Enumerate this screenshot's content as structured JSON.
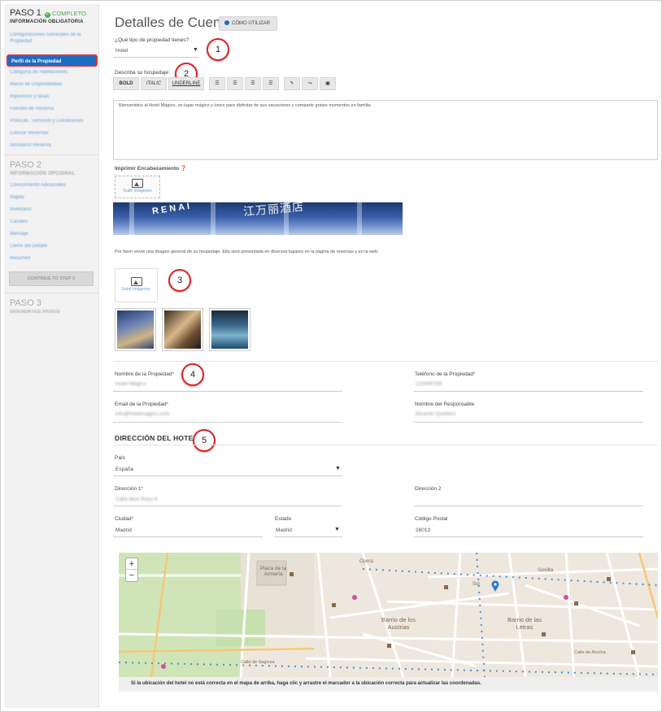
{
  "sidebar": {
    "step1": {
      "title": "PASO 1",
      "status": "COMPLETO",
      "subtitle": "INFORMACIÓN OBLIGATORIA"
    },
    "step1_items": [
      {
        "label": "Configuraciones Generales de la Propiedad"
      },
      {
        "label": "Perfil de la Propiedad",
        "active": true
      },
      {
        "label": "Categoría de Habitaciones"
      },
      {
        "label": "Marco de Disponibilidad"
      },
      {
        "label": "Impuestos y tasas"
      },
      {
        "label": "Fuentes de Reserva"
      },
      {
        "label": "Políticas, Términos y Condiciones"
      },
      {
        "label": "Colocar Reservas"
      },
      {
        "label": "Simulacro Reserva"
      }
    ],
    "step2": {
      "title": "PASO 2",
      "subtitle": "INFORMACIÓN OPCIONAL"
    },
    "step2_items": [
      {
        "label": "Conocimiento Adicionales"
      },
      {
        "label": "Mapas"
      },
      {
        "label": "Inventario"
      },
      {
        "label": "Canales"
      },
      {
        "label": "Mensaje"
      },
      {
        "label": "Cierre del Detalle"
      },
      {
        "label": "Resumen"
      }
    ],
    "continue_label": "CONTINUE TO STEP 3",
    "step3": {
      "title": "PASO 3",
      "subtitle": "SIGUIENTES PASOS"
    }
  },
  "header": {
    "title": "Detalles de Cuenta",
    "howto_label": "CÓMO UTILIZAR"
  },
  "property_type": {
    "label": "¿Qué tipo de propiedad tienes?",
    "value": "Hotel"
  },
  "description": {
    "label": "Describa su hospedaje:",
    "toolbar": [
      "BOLD",
      "ITALIC",
      "UNDERLINE"
    ],
    "text": "Bienvenidos al Hotel Mágico, un lugar mágico y único para disfrutar de sus vacaciones y compartir gratos momentos en familia."
  },
  "header_image": {
    "label": "Imprimir Encabezamiento",
    "upload_label": "Subir Imágenes"
  },
  "general_image": {
    "instruction": "Por favor envíe una imagen general de su hospedaje. Ella será presentada en diversos lugares en la página de reservas y en la web.",
    "upload_label": "Subir Imágenes"
  },
  "callouts": [
    "1",
    "2",
    "3",
    "4",
    "5"
  ],
  "fields": {
    "property_name": {
      "label": "Nombre de la Propiedad",
      "value": "Hotel Mágico"
    },
    "phone": {
      "label": "Teléfono de la Propiedad",
      "value": "123456789"
    },
    "email": {
      "label": "Email de la Propiedad",
      "value": "info@hotelmagico.com"
    },
    "manager": {
      "label": "Nombre del Responsable",
      "value": "Ricardo Quintero"
    }
  },
  "address": {
    "title": "DIRECCIÓN DEL HOTEL",
    "country_label": "País",
    "country_value": "España",
    "address1_label": "Dirección 1",
    "address1_value": "Calle Mon Reyo 6",
    "address2_label": "Dirección 2",
    "city_label": "Ciudad",
    "city_value": "Madrid",
    "state_label": "Estado",
    "state_value": "Madrid",
    "postal_label": "Código Postal",
    "postal_value": "28013"
  },
  "map": {
    "labels": [
      "Plaza de la Armería",
      "Barrio de los Austrias",
      "Barrio de las Letras",
      "Calle de Segovia",
      "Sevilla",
      "Sol",
      "Ópera",
      "Calle de Atocha"
    ],
    "caption": "Si la ubicación del hotel no está correcta en el mapa de arriba, haga clic y arrastre el marcador a la ubicación correcta para actualizar las coordenadas."
  }
}
